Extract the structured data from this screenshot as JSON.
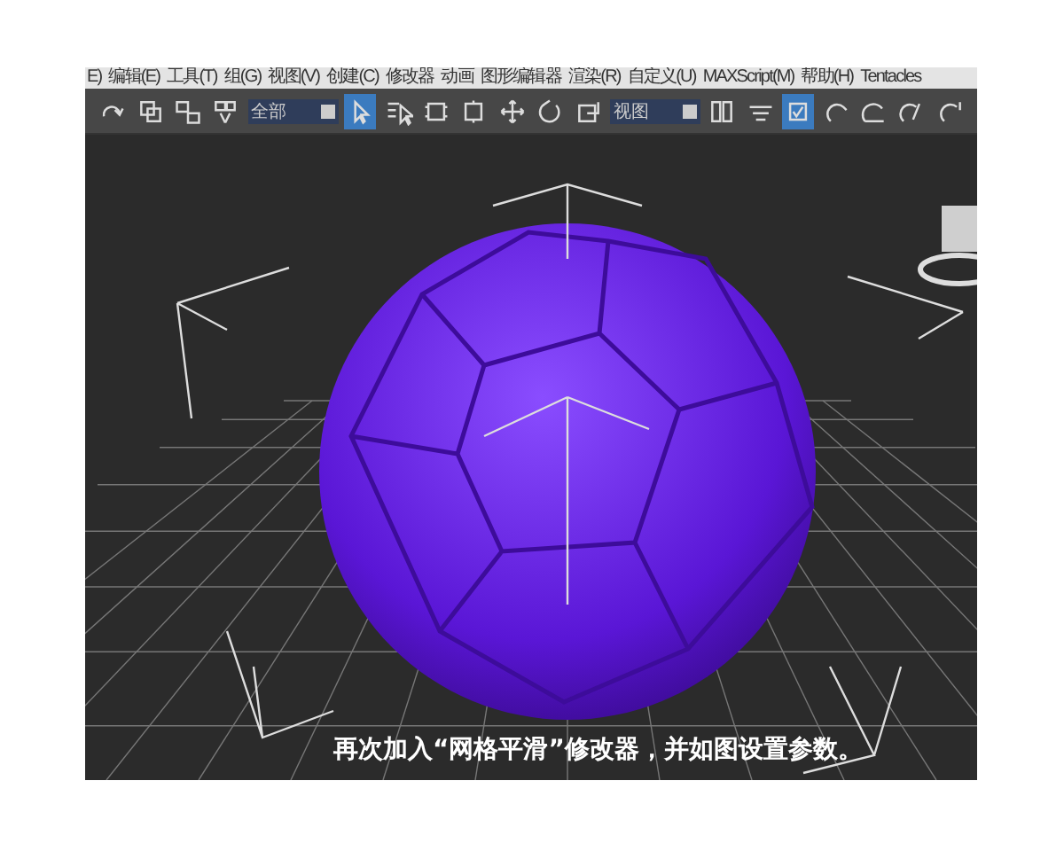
{
  "menu_bar": {
    "items": [
      "E)",
      "编辑(E)",
      "工具(T)",
      "组(G)",
      "视图(V)",
      "创建(C)",
      "修改器",
      "动画",
      "图形编辑器",
      "渲染(R)",
      "自定义(U)",
      "MAXScript(M)",
      "帮助(H)",
      "Tentacles"
    ]
  },
  "toolbar": {
    "items": [
      {
        "kind": "button",
        "selected": false
      },
      {
        "kind": "button",
        "selected": false
      },
      {
        "kind": "button",
        "selected": false
      },
      {
        "kind": "button",
        "selected": false
      },
      {
        "kind": "dropdown",
        "value": "全部"
      },
      {
        "kind": "button",
        "selected": true
      },
      {
        "kind": "button",
        "selected": false
      },
      {
        "kind": "button",
        "selected": false
      },
      {
        "kind": "button",
        "selected": false
      },
      {
        "kind": "button",
        "selected": false
      },
      {
        "kind": "button",
        "selected": false
      },
      {
        "kind": "button",
        "selected": false
      },
      {
        "kind": "dropdown",
        "value": "视图"
      },
      {
        "kind": "button",
        "selected": false
      },
      {
        "kind": "button",
        "selected": false
      },
      {
        "kind": "button",
        "selected": true
      },
      {
        "kind": "button",
        "selected": false
      },
      {
        "kind": "button",
        "selected": false
      },
      {
        "kind": "button",
        "selected": false
      },
      {
        "kind": "button",
        "selected": false
      }
    ]
  },
  "viewport": {
    "subtitle": "再次加入“网格平滑”修改器，并如图设置参数。"
  }
}
